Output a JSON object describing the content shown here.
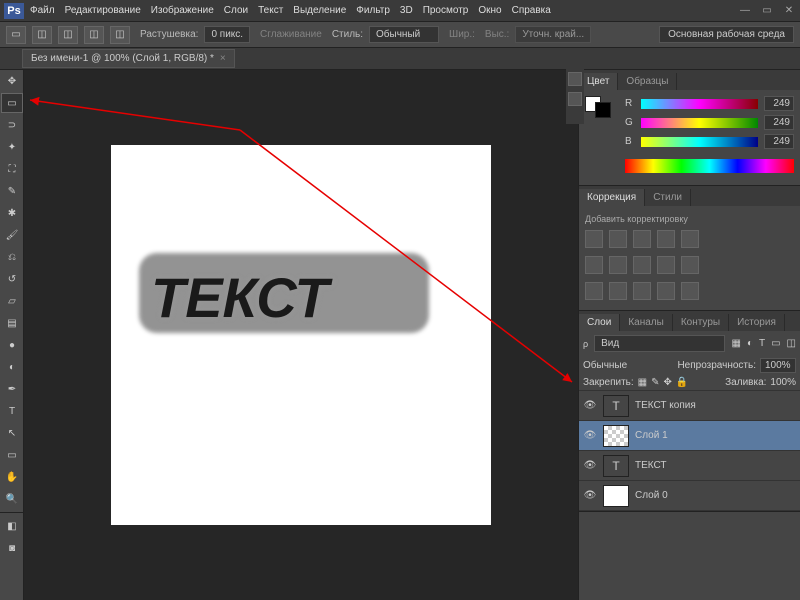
{
  "menu": {
    "items": [
      "Файл",
      "Редактирование",
      "Изображение",
      "Слои",
      "Текст",
      "Выделение",
      "Фильтр",
      "3D",
      "Просмотр",
      "Окно",
      "Справка"
    ]
  },
  "options": {
    "feather_label": "Растушевка:",
    "feather_value": "0 пикс.",
    "antialias": "Сглаживание",
    "style_label": "Стиль:",
    "style_value": "Обычный",
    "width_label": "Шир.:",
    "height_label": "Выс.:",
    "refine": "Уточн. край...",
    "workspace": "Основная рабочая среда"
  },
  "tab": {
    "title": "Без имени-1 @ 100% (Слой 1, RGB/8) *"
  },
  "canvas": {
    "text": "ТЕКСТ"
  },
  "color": {
    "tab1": "Цвет",
    "tab2": "Образцы",
    "r": "R",
    "g": "G",
    "b": "B",
    "rv": "249",
    "gv": "249",
    "bv": "249"
  },
  "corrections": {
    "tab1": "Коррекция",
    "tab2": "Стили",
    "add": "Добавить корректировку"
  },
  "layers": {
    "tab1": "Слои",
    "tab2": "Каналы",
    "tab3": "Контуры",
    "tab4": "История",
    "kind": "Вид",
    "blend": "Обычные",
    "opacity_label": "Непрозрачность:",
    "opacity": "100%",
    "lock_label": "Закрепить:",
    "fill_label": "Заливка:",
    "fill": "100%",
    "items": [
      {
        "name": "ТЕКСТ копия",
        "type": "text"
      },
      {
        "name": "Слой 1",
        "type": "raster",
        "selected": true
      },
      {
        "name": "ТЕКСТ",
        "type": "text"
      },
      {
        "name": "Слой 0",
        "type": "raster"
      }
    ]
  }
}
